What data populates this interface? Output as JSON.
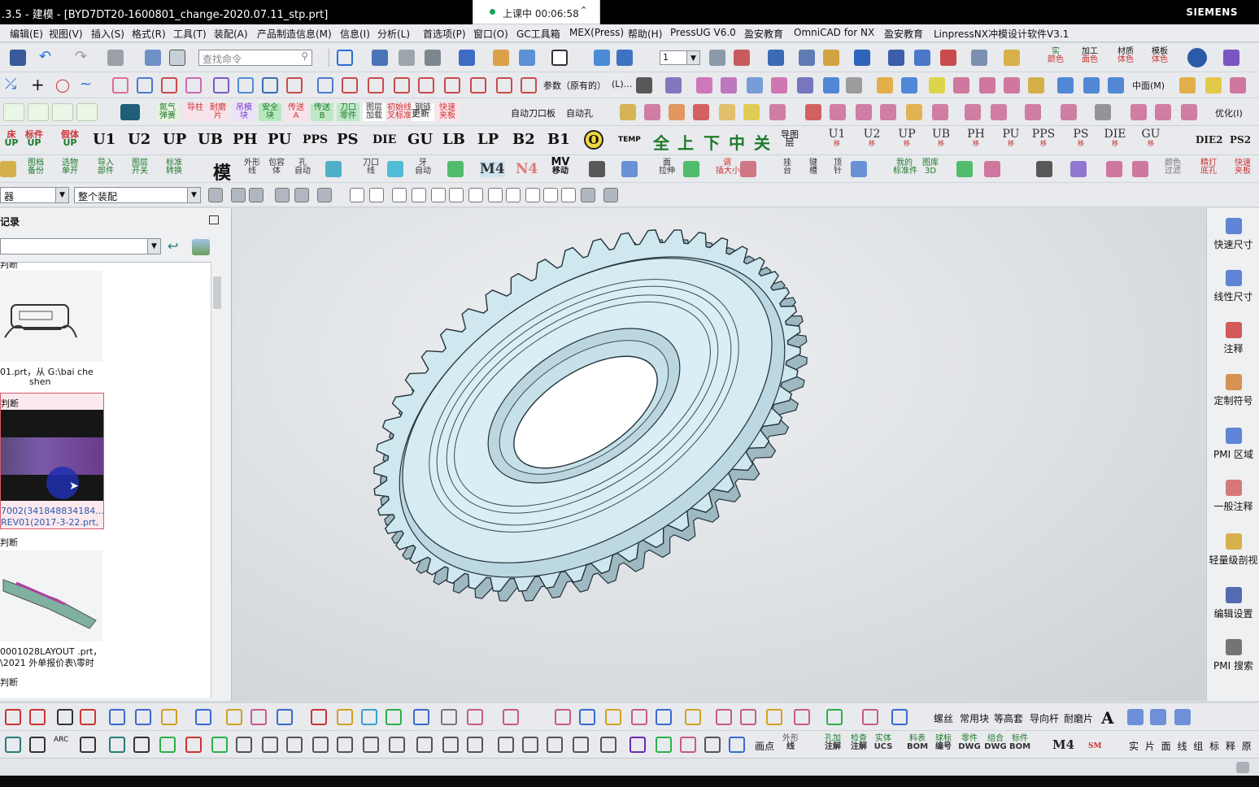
{
  "titlebar": {
    "title": ".3.5 - 建模 - [BYD7DT20-1600801_change-2020.07.11_stp.prt]",
    "brand": "SIEMENS"
  },
  "recorder": {
    "label": "上课中 00:06:58"
  },
  "menu": [
    "编辑(E)",
    "视图(V)",
    "插入(S)",
    "格式(R)",
    "工具(T)",
    "装配(A)",
    "产品制造信息(M)",
    "信息(I)",
    "分析(L)",
    "首选项(P)",
    "窗口(O)",
    "GC工具箱",
    "MEX(Press)",
    "帮助(H)",
    "PressUG V6.0",
    "盈安教育",
    "OmniCAD for NX",
    "盈安教育",
    "LinpressNX冲模设计软件V3.1"
  ],
  "toolbar1": {
    "search_placeholder": "查找命令",
    "layer_value": "1",
    "right_labels": [
      {
        "top": "实",
        "bottom": "颜色"
      },
      {
        "top": "加工",
        "bottom": "面色"
      },
      {
        "top": "材质",
        "bottom": "体色"
      },
      {
        "top": "模板",
        "bottom": "体色"
      }
    ]
  },
  "toolbar2": {
    "param_label": "参数（原有的）",
    "param_suffix": "(L)...",
    "mid_label": "中面(M)"
  },
  "toolbar3": {
    "labels": [
      "自动刀口板",
      "自动孔",
      "更新",
      "优化(I)"
    ],
    "tags": [
      {
        "top": "氮气",
        "bottom": "弹簧"
      },
      {
        "top": "导柱",
        "bottom": ""
      },
      {
        "top": "耐磨",
        "bottom": "片"
      },
      {
        "top": "吊模",
        "bottom": "块"
      },
      {
        "top": "安全",
        "bottom": "块"
      },
      {
        "top": "传送",
        "bottom": "A"
      },
      {
        "top": "传送",
        "bottom": "B"
      },
      {
        "top": "刀口",
        "bottom": "零件"
      },
      {
        "top": "图层",
        "bottom": "加载"
      },
      {
        "top": "初始线",
        "bottom": "叉标准"
      },
      {
        "top": "钢链",
        "bottom": ""
      },
      {
        "top": "快速",
        "bottom": "夹板"
      }
    ]
  },
  "toolbar4": {
    "left_tags": [
      {
        "top": "床",
        "bottom": "UP"
      },
      {
        "top": "标件",
        "bottom": "UP"
      },
      {
        "top": "假体",
        "bottom": "UP"
      }
    ],
    "big_labels": [
      "U1",
      "U2",
      "UP",
      "UB",
      "PH",
      "PU",
      "PPS",
      "PS",
      "DIE",
      "GU",
      "LB",
      "LP",
      "B2",
      "B1"
    ],
    "circle_label": "O",
    "temp": "TEMP",
    "cn": [
      "全",
      "上",
      "下",
      "中",
      "关"
    ],
    "daotu": {
      "top": "导图",
      "bottom": "层"
    },
    "right_labels": [
      "U1",
      "U2",
      "UP",
      "UB",
      "PH",
      "PU",
      "PPS",
      "PS",
      "DIE",
      "GU"
    ],
    "sub": "移",
    "far_right": [
      "DIE2",
      "PS2"
    ]
  },
  "toolbar5": {
    "tags": [
      {
        "top": "图档",
        "bottom": "备份"
      },
      {
        "top": "选物",
        "bottom": "单开"
      },
      {
        "top": "导入",
        "bottom": "部件"
      },
      {
        "top": "图层",
        "bottom": "开关"
      },
      {
        "top": "标准",
        "bottom": "转换"
      },
      {
        "top": "外形",
        "bottom": "线"
      },
      {
        "top": "包容",
        "bottom": "体"
      },
      {
        "top": "孔",
        "bottom": "自动"
      },
      {
        "top": "刀口",
        "bottom": "线"
      },
      {
        "top": "牙",
        "bottom": "自动"
      },
      {
        "top": "面",
        "bottom": "拉伸"
      },
      {
        "top": "调",
        "bottom": "插大小"
      },
      {
        "top": "挂",
        "bottom": "台"
      },
      {
        "top": "键",
        "bottom": "槽"
      },
      {
        "top": "顶",
        "bottom": "针"
      },
      {
        "top": "我的",
        "bottom": "标准件"
      },
      {
        "top": "图库",
        "bottom": "3D"
      },
      {
        "top": "颜色",
        "bottom": "过滤"
      },
      {
        "top": "精灯",
        "bottom": "底孔"
      },
      {
        "top": "快速",
        "bottom": "夹板"
      }
    ],
    "big_left": "模",
    "m4": "M4",
    "n4": "N4",
    "mv": {
      "top": "MV",
      "bottom": "移动"
    }
  },
  "selection_bar": {
    "filter_value": "器",
    "scope_value": "整个装配"
  },
  "history_panel": {
    "title": "记录",
    "items": [
      {
        "group": "判断",
        "caption1": "01.prt，从 G:\\bai che",
        "caption2": "shen"
      },
      {
        "group": "判断",
        "caption1": "7002(341848834184...",
        "caption2": "REV01(2017-3-22.prt,"
      },
      {
        "group": "判断",
        "caption1": "0001028LAYOUT .prt，",
        "caption2": "\\2021 外单报价表\\零时"
      },
      {
        "group": "判断",
        "caption1": "",
        "caption2": ""
      }
    ]
  },
  "right_panel": [
    {
      "label": "快速尺寸",
      "icon": "quick-dimension-icon"
    },
    {
      "label": "线性尺寸",
      "icon": "linear-dimension-icon"
    },
    {
      "label": "注释",
      "icon": "note-icon"
    },
    {
      "label": "定制符号",
      "icon": "custom-symbol-icon"
    },
    {
      "label": "PMI 区域",
      "icon": "pmi-region-icon"
    },
    {
      "label": "一般注释",
      "icon": "general-note-icon"
    },
    {
      "label": "轻量级剖视",
      "icon": "lightweight-section-icon"
    },
    {
      "label": "编辑设置",
      "icon": "edit-settings-icon"
    },
    {
      "label": "PMI 搜索",
      "icon": "pmi-search-icon"
    }
  ],
  "bottom_toolbar1": {
    "labels": [
      "螺丝",
      "常用块",
      "等高套",
      "导向杆",
      "耐磨片"
    ],
    "big": "A"
  },
  "bottom_toolbar2": {
    "arc": "ARC",
    "point_label": "画点",
    "tags": [
      {
        "top": "外形",
        "bottom": "线"
      },
      {
        "top": "孔加",
        "bottom": "注解"
      },
      {
        "top": "检查",
        "bottom": "注解"
      },
      {
        "top": "实体",
        "bottom": "UCS"
      },
      {
        "top": "料表",
        "bottom": "BOM"
      },
      {
        "top": "球标",
        "bottom": "编号"
      },
      {
        "top": "零件",
        "bottom": "DWG"
      },
      {
        "top": "组合",
        "bottom": "DWG"
      },
      {
        "top": "标件",
        "bottom": "BOM"
      }
    ],
    "m4": "M4",
    "sm": "SM",
    "chars": "实 片 面 线 组 标 释 原"
  },
  "colors": {
    "title_bg": "#000000",
    "part_face": "#cfe7ef",
    "part_edge": "#24323a",
    "viewport_bg": "#e2e5e8",
    "accent_blue": "#2a6fd0"
  }
}
